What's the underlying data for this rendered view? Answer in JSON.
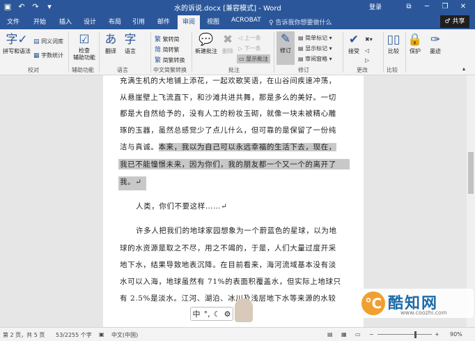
{
  "titlebar": {
    "title": "水的诉说.docx [兼容模式] - Word",
    "login": "登录",
    "qat_icons": [
      "save-icon",
      "undo-icon",
      "redo-icon",
      "customize-icon"
    ]
  },
  "tabs": [
    "文件",
    "开始",
    "插入",
    "设计",
    "布局",
    "引用",
    "邮件",
    "审阅",
    "视图",
    "ACROBAT"
  ],
  "active_tab": "审阅",
  "tell_me": "♀ 告诉我你想要做什么",
  "share": "♂ 共享",
  "ribbon": {
    "proofing": {
      "spelling": "拼写和语法",
      "thesaurus": "同义词库",
      "wordcount": "字数统计",
      "group": "校对"
    },
    "accessibility": {
      "check": "检查\n辅助功能",
      "group": "辅助功能"
    },
    "language": {
      "translate": "翻译",
      "language": "语言",
      "group": "语言"
    },
    "chinese": {
      "to_simplified": "繁转简",
      "to_traditional": "简转繁",
      "convert": "简繁转换",
      "group": "中文简繁转换"
    },
    "comments": {
      "new": "新建批注",
      "delete": "删除",
      "prev": "上一条",
      "next": "下一条",
      "show": "显示批注",
      "group": "批注"
    },
    "tracking": {
      "track": "修订",
      "simple_markup": "简单标记",
      "show_markup": "显示标记",
      "review_pane": "审阅窗格",
      "group": "修订"
    },
    "changes": {
      "accept": "接受",
      "group": "更改"
    },
    "compare": {
      "compare": "比较",
      "group": "比较"
    },
    "protect": {
      "protect": "保护",
      "ink": "墨迹"
    }
  },
  "document": {
    "lines": [
      "充满生机的大地铺上添花，一起欢歌笑语，在山谷间疾速冲荡，",
      "从悬崖壁上飞流直下，和沙滩共进共舞，那是多么的美好。一切",
      "都是大自然给予的，没有人工的粉妆玉砌，就像一块未被精心雕",
      "琢的玉器，虽然总感觉少了点儿什么，但可靠的是保留了一份纯",
      "洁与真诚。本来，我以为自己可以永远幸福的生活下去，现在，",
      "我已不能憧憬未来，因为你们，我的朋友都一个又一个的离开了",
      "我。↵",
      "人类，你们不要这样……↵",
      "许多人把我们的地球家园想象为一个蔚蓝色的星球，以为地",
      "球的水资源是取之不尽，用之不竭的，于是，人们大量过度开采",
      "地下水，结果导致地表沉降。在目前看来，海河流域基本没有淡",
      "水可以入海，地球虽然有 71%的表面积覆盖水，但实际上地球只",
      "有 2.5%是淡水。江河、湖泊、冰川及浅层地下水等来源的水较"
    ]
  },
  "ime": {
    "lang": "中",
    "symbols": "°,",
    "moon": "☾",
    "gear": "⚙"
  },
  "watermark": {
    "logo": "℃",
    "name": "酷知网",
    "url": "www.coozhi.com"
  },
  "status": {
    "page": "第 2 页，共 5 页",
    "words": "53/2255 个字",
    "lang": "中文(中国)",
    "zoom": "90%"
  },
  "colors": {
    "word_blue": "#2b579a",
    "selection": "#c8c8c8"
  }
}
